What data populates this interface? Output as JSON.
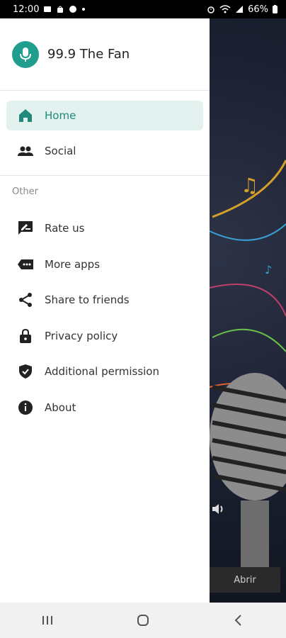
{
  "status_bar": {
    "time": "12:00",
    "battery": "66%"
  },
  "drawer": {
    "app_title": "99.9 The Fan",
    "main_items": [
      {
        "label": "Home",
        "icon": "home-icon",
        "active": true
      },
      {
        "label": "Social",
        "icon": "people-icon",
        "active": false
      }
    ],
    "section_title": "Other",
    "other_items": [
      {
        "label": "Rate us",
        "icon": "rate-icon"
      },
      {
        "label": "More apps",
        "icon": "more-apps-icon"
      },
      {
        "label": "Share to friends",
        "icon": "share-icon"
      },
      {
        "label": "Privacy policy",
        "icon": "lock-icon"
      },
      {
        "label": "Additional permission",
        "icon": "shield-icon"
      },
      {
        "label": "About",
        "icon": "info-icon"
      }
    ]
  },
  "background": {
    "button_label": "Abrir"
  },
  "colors": {
    "accent": "#1f9e8e",
    "active_bg": "#e3f1ef"
  }
}
